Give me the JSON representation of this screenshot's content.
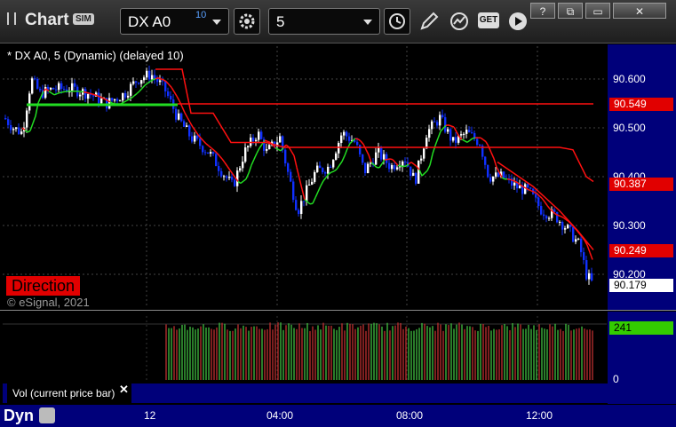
{
  "app": {
    "title": "Chart",
    "badge": "SIM"
  },
  "toolbar": {
    "symbol": "DX A0",
    "symbol_superscript": "10",
    "interval": "5",
    "get_label": "GET",
    "window_buttons": [
      "?",
      "⧉",
      "▭",
      "✕"
    ]
  },
  "chart": {
    "title": "* DX A0, 5 (Dynamic) (delayed 10)",
    "study_label": "Direction",
    "copyright": "© eSignal, 2021"
  },
  "price_axis": {
    "ticks": [
      "90.600",
      "90.500",
      "90.400",
      "90.300",
      "90.200"
    ],
    "tags": [
      {
        "label": "90.549",
        "bg": "#e10000",
        "fg": "#ffffff"
      },
      {
        "label": "90.387",
        "bg": "#e10000",
        "fg": "#ffffff"
      },
      {
        "label": "90.249",
        "bg": "#e10000",
        "fg": "#ffffff"
      },
      {
        "label": "90.179",
        "bg": "#ffffff",
        "fg": "#000000"
      }
    ]
  },
  "volume": {
    "label": "Vol (current price bar)",
    "close": "✕",
    "tag": "241",
    "tag_color": "#33cc00",
    "zero_tick": "0"
  },
  "time_axis": {
    "dyn": "Dyn",
    "labels": [
      "12",
      "04:00",
      "08:00",
      "12:00"
    ]
  },
  "chart_data": {
    "type": "candlestick",
    "title": "* DX A0, 5 (Dynamic) (delayed 10)",
    "y_axis_ticks": [
      90.6,
      90.5,
      90.4,
      90.3,
      90.2
    ],
    "x_axis_ticks": [
      "12",
      "04:00",
      "08:00",
      "12:00"
    ],
    "resistance_level": 90.549,
    "last_price": 90.179,
    "ma_last": 90.387,
    "trend_last": 90.249,
    "colors": {
      "up": "#ffffff",
      "down": "#1030ff",
      "ma_up": "#22dd22",
      "ma_down": "#ff1010",
      "vol_up": "#40c040",
      "vol_down": "#c03030"
    }
  }
}
